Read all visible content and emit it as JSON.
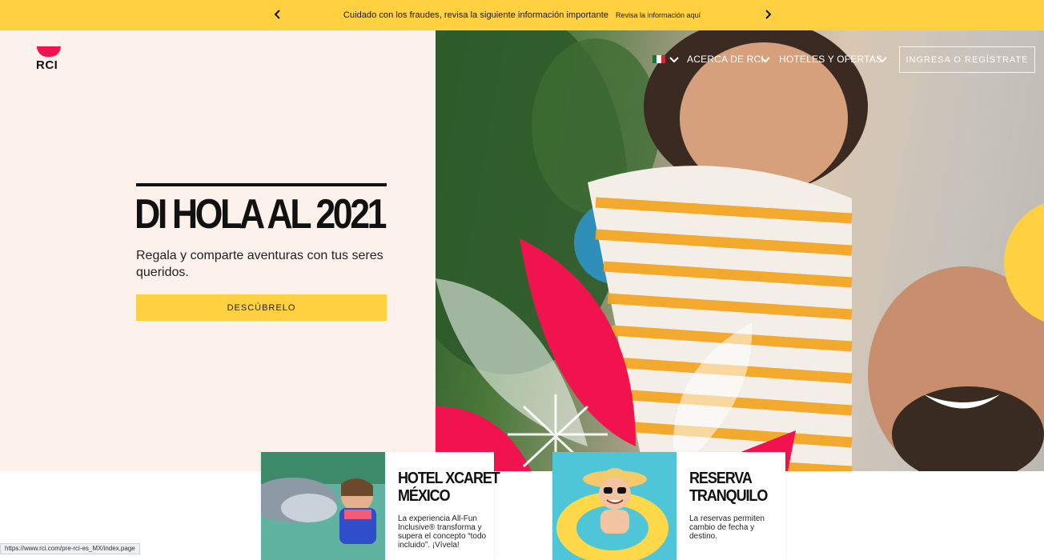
{
  "alert": {
    "message": "Cuidado con los fraudes, revisa la siguiente información importante",
    "link": "Revisa la información aquí"
  },
  "brand": {
    "logo_text": "RCI",
    "accent": "#F0134D",
    "yellow": "#FFD03F"
  },
  "nav": {
    "about": "ACERCA DE RCI",
    "hotels": "HOTELES Y OFERTAS",
    "login": "INGRESA O REGÍSTRATE"
  },
  "hero": {
    "title": "DI HOLA AL 2021",
    "subtitle": "Regala y comparte aventuras con tus seres queridos.",
    "cta": "DESCÚBRELO"
  },
  "cards": [
    {
      "title_line1": "HOTEL XCARET",
      "title_line2": "MÉXICO",
      "text": "La experiencia All-Fun Inclusive® transforma y supera el concepto “todo incluido”. ¡Vívela!"
    },
    {
      "title_line1": "RESERVA",
      "title_line2": "TRANQUILO",
      "text": "La reservas permiten cambio de fecha y destino."
    }
  ],
  "status_bar": {
    "url": "https://www.rci.com/pre-rci-es_MX/index.page"
  }
}
